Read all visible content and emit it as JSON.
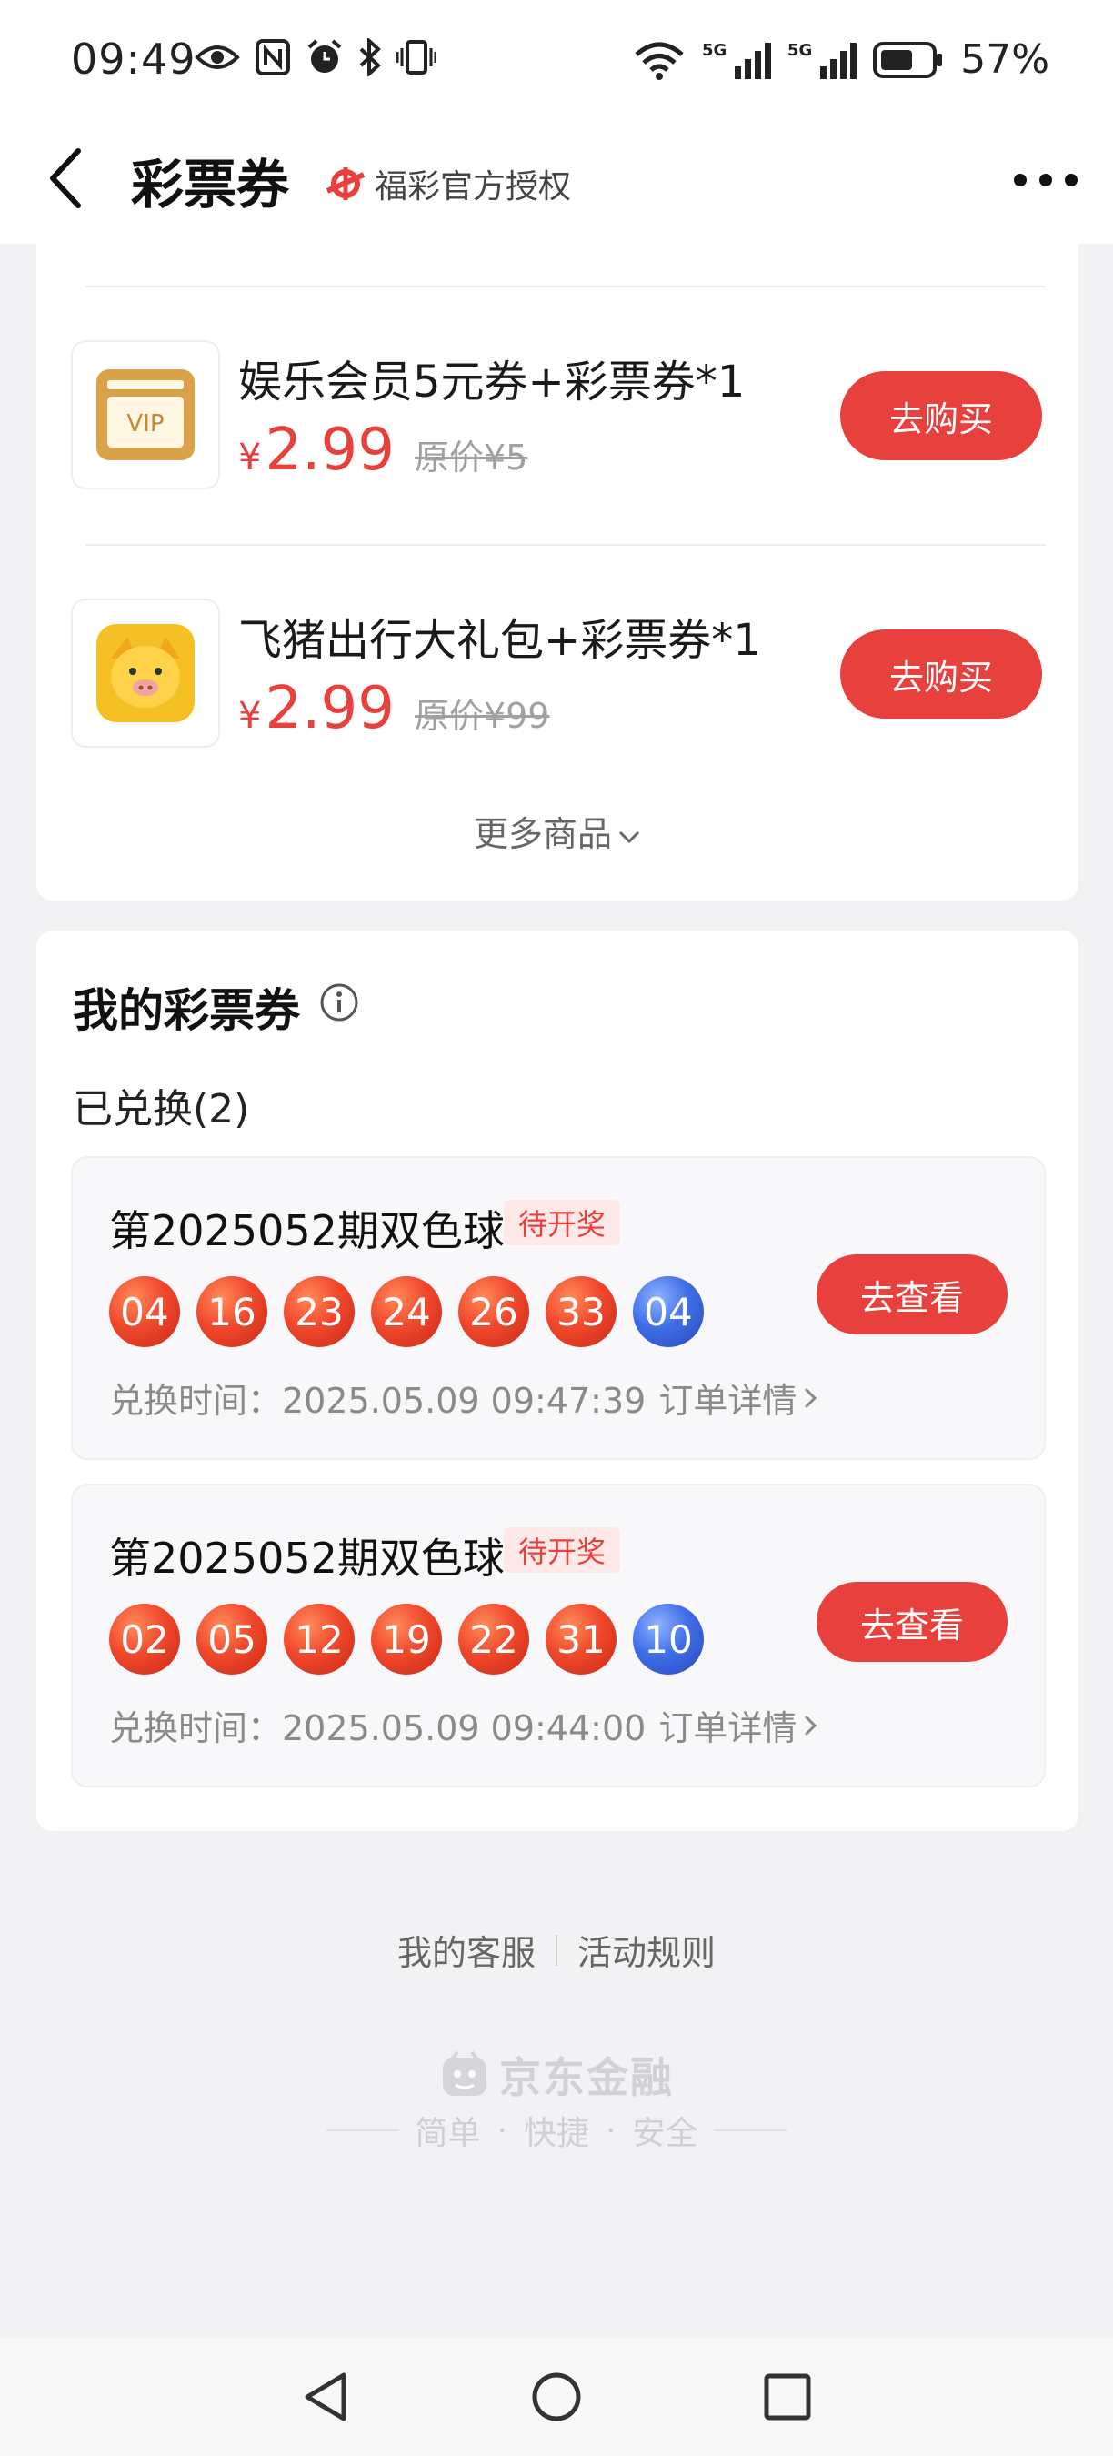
{
  "status_bar": {
    "time": "09:49",
    "network_label_1": "5G",
    "network_label_2": "5G",
    "battery": "57%"
  },
  "header": {
    "title": "彩票券",
    "auth_label": "福彩官方授权"
  },
  "products": [
    {
      "name": "娱乐会员5元券+彩票券*1",
      "price_symbol": "¥",
      "price": "2.99",
      "original_price": "原价¥5",
      "button": "去购买",
      "icon": "vip-card-icon"
    },
    {
      "name": "飞猪出行大礼包+彩票券*1",
      "price_symbol": "¥",
      "price": "2.99",
      "original_price": "原价¥99",
      "button": "去购买",
      "icon": "fliggy-pig-icon"
    }
  ],
  "more_products_label": "更多商品",
  "my_coupons": {
    "title": "我的彩票券",
    "exchanged_label": "已兑换(2)",
    "tickets": [
      {
        "title": "第2025052期双色球",
        "status": "待开奖",
        "red_balls": [
          "04",
          "16",
          "23",
          "24",
          "26",
          "33"
        ],
        "blue_ball": "04",
        "time": "兑换时间：2025.05.09 09:47:39",
        "order_link": "订单详情",
        "button": "去查看"
      },
      {
        "title": "第2025052期双色球",
        "status": "待开奖",
        "red_balls": [
          "02",
          "05",
          "12",
          "19",
          "22",
          "31"
        ],
        "blue_ball": "10",
        "time": "兑换时间：2025.05.09 09:44:00",
        "order_link": "订单详情",
        "button": "去查看"
      }
    ]
  },
  "footer": {
    "service": "我的客服",
    "rules": "活动规则",
    "brand": "京东金融",
    "slogan": [
      "简单",
      "快捷",
      "安全"
    ]
  },
  "colors": {
    "accent": "#e8403c",
    "red_ball": "#f0482c",
    "blue_ball": "#3f6ee8"
  }
}
